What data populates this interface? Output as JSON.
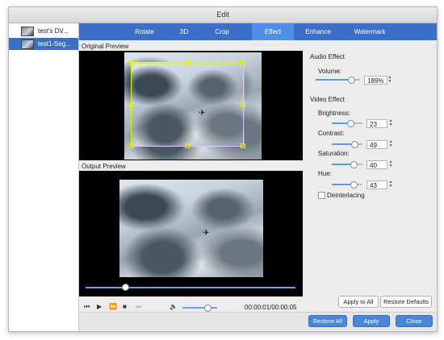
{
  "window": {
    "title": "Edit"
  },
  "files": [
    {
      "name": "test's DV..."
    },
    {
      "name": "test1-Seg..."
    }
  ],
  "tabs": [
    "Rotate",
    "3D",
    "Crop",
    "Effect",
    "Enhance",
    "Watermark"
  ],
  "active_tab": "Effect",
  "preview": {
    "original_label": "Original Preview",
    "output_label": "Output Preview"
  },
  "player": {
    "seek_position": 0.19,
    "volume_level": 0.72,
    "timecode": "00:00:01/00:00:05",
    "volume_icon": "speaker-icon"
  },
  "audio_effect": {
    "title": "Audio Effect",
    "volume": {
      "label": "Volume:",
      "value": "189%",
      "level": 0.8
    }
  },
  "video_effect": {
    "title": "Video Effect",
    "brightness": {
      "label": "Brightness:",
      "value": "23",
      "level": 0.6
    },
    "contrast": {
      "label": "Contrast:",
      "value": "49",
      "level": 0.74
    },
    "saturation": {
      "label": "Saturation:",
      "value": "40",
      "level": 0.7
    },
    "hue": {
      "label": "Hue:",
      "value": "43",
      "level": 0.72
    },
    "deinterlacing": {
      "label": "Deinterlacing",
      "checked": false
    }
  },
  "buttons": {
    "apply_to_all": "Apply to All",
    "restore_defaults": "Restore Defaults",
    "restore_all": "Restore All",
    "apply": "Apply",
    "close": "Close"
  },
  "colors": {
    "tab_bar": "#3b6fc7",
    "tab_active": "#4e8ee8",
    "crop_frame": "#ecec10",
    "slider_fill": "#5a9be6",
    "primary_button": "#4a86d8"
  }
}
